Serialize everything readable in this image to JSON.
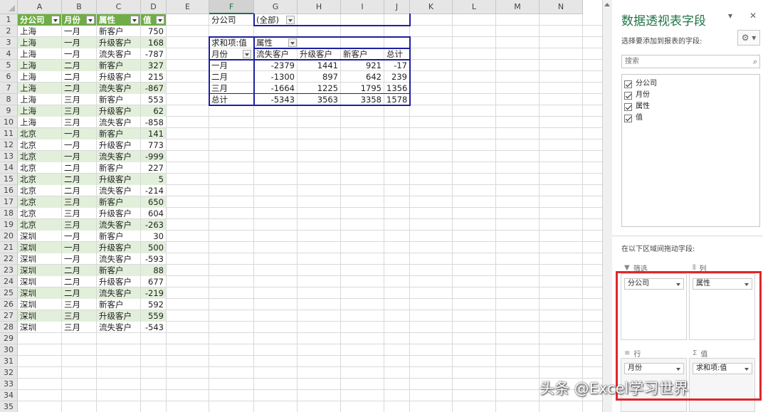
{
  "columns": [
    "A",
    "B",
    "C",
    "D",
    "E",
    "F",
    "G",
    "H",
    "I",
    "J",
    "K",
    "L",
    "M",
    "N"
  ],
  "selected_column": "F",
  "source_headers": [
    "分公司",
    "月份",
    "属性",
    "值"
  ],
  "source_rows": [
    [
      "上海",
      "一月",
      "新客户",
      "750"
    ],
    [
      "上海",
      "一月",
      "升级客户",
      "168"
    ],
    [
      "上海",
      "一月",
      "流失客户",
      "-787"
    ],
    [
      "上海",
      "二月",
      "新客户",
      "327"
    ],
    [
      "上海",
      "二月",
      "升级客户",
      "215"
    ],
    [
      "上海",
      "二月",
      "流失客户",
      "-867"
    ],
    [
      "上海",
      "三月",
      "新客户",
      "553"
    ],
    [
      "上海",
      "三月",
      "升级客户",
      "62"
    ],
    [
      "上海",
      "三月",
      "流失客户",
      "-858"
    ],
    [
      "北京",
      "一月",
      "新客户",
      "141"
    ],
    [
      "北京",
      "一月",
      "升级客户",
      "773"
    ],
    [
      "北京",
      "一月",
      "流失客户",
      "-999"
    ],
    [
      "北京",
      "二月",
      "新客户",
      "227"
    ],
    [
      "北京",
      "二月",
      "升级客户",
      "5"
    ],
    [
      "北京",
      "二月",
      "流失客户",
      "-214"
    ],
    [
      "北京",
      "三月",
      "新客户",
      "650"
    ],
    [
      "北京",
      "三月",
      "升级客户",
      "604"
    ],
    [
      "北京",
      "三月",
      "流失客户",
      "-263"
    ],
    [
      "深圳",
      "一月",
      "新客户",
      "30"
    ],
    [
      "深圳",
      "一月",
      "升级客户",
      "500"
    ],
    [
      "深圳",
      "一月",
      "流失客户",
      "-593"
    ],
    [
      "深圳",
      "二月",
      "新客户",
      "88"
    ],
    [
      "深圳",
      "二月",
      "升级客户",
      "677"
    ],
    [
      "深圳",
      "二月",
      "流失客户",
      "-219"
    ],
    [
      "深圳",
      "三月",
      "新客户",
      "592"
    ],
    [
      "深圳",
      "三月",
      "升级客户",
      "559"
    ],
    [
      "深圳",
      "三月",
      "流失客户",
      "-543"
    ]
  ],
  "row_numbers": [
    "1",
    "2",
    "3",
    "4",
    "5",
    "6",
    "7",
    "8",
    "9",
    "10",
    "11",
    "12",
    "13",
    "14",
    "15",
    "16",
    "17",
    "18",
    "19",
    "20",
    "21",
    "22",
    "23",
    "24",
    "25",
    "26",
    "27",
    "28",
    "29",
    "30",
    "31",
    "32",
    "33",
    "34",
    "35"
  ],
  "pivot": {
    "filter_label": "分公司",
    "filter_value": "(全部)",
    "values_label": "求和项:值",
    "column_field": "属性",
    "row_field": "月份",
    "col_headers": [
      "流失客户",
      "升级客户",
      "新客户",
      "总计"
    ],
    "rows": [
      {
        "label": "一月",
        "values": [
          "-2379",
          "1441",
          "921",
          "-17"
        ]
      },
      {
        "label": "二月",
        "values": [
          "-1300",
          "897",
          "642",
          "239"
        ]
      },
      {
        "label": "三月",
        "values": [
          "-1664",
          "1225",
          "1795",
          "1356"
        ]
      },
      {
        "label": "总计",
        "values": [
          "-5343",
          "3563",
          "3358",
          "1578"
        ]
      }
    ]
  },
  "pane": {
    "title": "数据透视表字段",
    "subtitle": "选择要添加到报表的字段:",
    "search_placeholder": "搜索",
    "fields": [
      "分公司",
      "月份",
      "属性",
      "值"
    ],
    "drag_label": "在以下区域间拖动字段:",
    "areas": {
      "filter_label": "筛选",
      "filter_item": "分公司",
      "columns_label": "列",
      "columns_item": "属性",
      "rows_label": "行",
      "rows_item": "月份",
      "values_label": "值",
      "values_item": "求和项:值"
    }
  },
  "icons": {
    "pane_dropdown": "chevron-down-icon",
    "pane_close": "close-icon",
    "gear": "gear-icon",
    "search": "search-icon",
    "filter": "filter-icon",
    "columns": "columns-icon",
    "rows": "rows-icon",
    "sigma": "sigma-icon"
  },
  "watermark": "头条 @Excel学习世界"
}
